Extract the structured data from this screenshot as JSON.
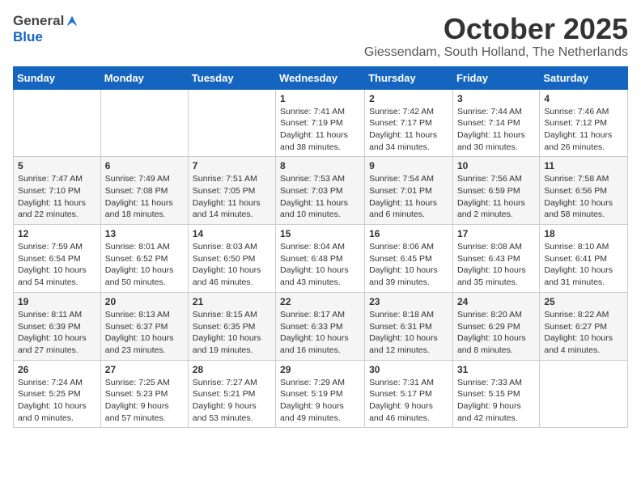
{
  "header": {
    "logo_general": "General",
    "logo_blue": "Blue",
    "month_title": "October 2025",
    "location": "Giessendam, South Holland, The Netherlands"
  },
  "calendar": {
    "days_of_week": [
      "Sunday",
      "Monday",
      "Tuesday",
      "Wednesday",
      "Thursday",
      "Friday",
      "Saturday"
    ],
    "weeks": [
      [
        {
          "day": "",
          "info": ""
        },
        {
          "day": "",
          "info": ""
        },
        {
          "day": "",
          "info": ""
        },
        {
          "day": "1",
          "info": "Sunrise: 7:41 AM\nSunset: 7:19 PM\nDaylight: 11 hours\nand 38 minutes."
        },
        {
          "day": "2",
          "info": "Sunrise: 7:42 AM\nSunset: 7:17 PM\nDaylight: 11 hours\nand 34 minutes."
        },
        {
          "day": "3",
          "info": "Sunrise: 7:44 AM\nSunset: 7:14 PM\nDaylight: 11 hours\nand 30 minutes."
        },
        {
          "day": "4",
          "info": "Sunrise: 7:46 AM\nSunset: 7:12 PM\nDaylight: 11 hours\nand 26 minutes."
        }
      ],
      [
        {
          "day": "5",
          "info": "Sunrise: 7:47 AM\nSunset: 7:10 PM\nDaylight: 11 hours\nand 22 minutes."
        },
        {
          "day": "6",
          "info": "Sunrise: 7:49 AM\nSunset: 7:08 PM\nDaylight: 11 hours\nand 18 minutes."
        },
        {
          "day": "7",
          "info": "Sunrise: 7:51 AM\nSunset: 7:05 PM\nDaylight: 11 hours\nand 14 minutes."
        },
        {
          "day": "8",
          "info": "Sunrise: 7:53 AM\nSunset: 7:03 PM\nDaylight: 11 hours\nand 10 minutes."
        },
        {
          "day": "9",
          "info": "Sunrise: 7:54 AM\nSunset: 7:01 PM\nDaylight: 11 hours\nand 6 minutes."
        },
        {
          "day": "10",
          "info": "Sunrise: 7:56 AM\nSunset: 6:59 PM\nDaylight: 11 hours\nand 2 minutes."
        },
        {
          "day": "11",
          "info": "Sunrise: 7:58 AM\nSunset: 6:56 PM\nDaylight: 10 hours\nand 58 minutes."
        }
      ],
      [
        {
          "day": "12",
          "info": "Sunrise: 7:59 AM\nSunset: 6:54 PM\nDaylight: 10 hours\nand 54 minutes."
        },
        {
          "day": "13",
          "info": "Sunrise: 8:01 AM\nSunset: 6:52 PM\nDaylight: 10 hours\nand 50 minutes."
        },
        {
          "day": "14",
          "info": "Sunrise: 8:03 AM\nSunset: 6:50 PM\nDaylight: 10 hours\nand 46 minutes."
        },
        {
          "day": "15",
          "info": "Sunrise: 8:04 AM\nSunset: 6:48 PM\nDaylight: 10 hours\nand 43 minutes."
        },
        {
          "day": "16",
          "info": "Sunrise: 8:06 AM\nSunset: 6:45 PM\nDaylight: 10 hours\nand 39 minutes."
        },
        {
          "day": "17",
          "info": "Sunrise: 8:08 AM\nSunset: 6:43 PM\nDaylight: 10 hours\nand 35 minutes."
        },
        {
          "day": "18",
          "info": "Sunrise: 8:10 AM\nSunset: 6:41 PM\nDaylight: 10 hours\nand 31 minutes."
        }
      ],
      [
        {
          "day": "19",
          "info": "Sunrise: 8:11 AM\nSunset: 6:39 PM\nDaylight: 10 hours\nand 27 minutes."
        },
        {
          "day": "20",
          "info": "Sunrise: 8:13 AM\nSunset: 6:37 PM\nDaylight: 10 hours\nand 23 minutes."
        },
        {
          "day": "21",
          "info": "Sunrise: 8:15 AM\nSunset: 6:35 PM\nDaylight: 10 hours\nand 19 minutes."
        },
        {
          "day": "22",
          "info": "Sunrise: 8:17 AM\nSunset: 6:33 PM\nDaylight: 10 hours\nand 16 minutes."
        },
        {
          "day": "23",
          "info": "Sunrise: 8:18 AM\nSunset: 6:31 PM\nDaylight: 10 hours\nand 12 minutes."
        },
        {
          "day": "24",
          "info": "Sunrise: 8:20 AM\nSunset: 6:29 PM\nDaylight: 10 hours\nand 8 minutes."
        },
        {
          "day": "25",
          "info": "Sunrise: 8:22 AM\nSunset: 6:27 PM\nDaylight: 10 hours\nand 4 minutes."
        }
      ],
      [
        {
          "day": "26",
          "info": "Sunrise: 7:24 AM\nSunset: 5:25 PM\nDaylight: 10 hours\nand 0 minutes."
        },
        {
          "day": "27",
          "info": "Sunrise: 7:25 AM\nSunset: 5:23 PM\nDaylight: 9 hours\nand 57 minutes."
        },
        {
          "day": "28",
          "info": "Sunrise: 7:27 AM\nSunset: 5:21 PM\nDaylight: 9 hours\nand 53 minutes."
        },
        {
          "day": "29",
          "info": "Sunrise: 7:29 AM\nSunset: 5:19 PM\nDaylight: 9 hours\nand 49 minutes."
        },
        {
          "day": "30",
          "info": "Sunrise: 7:31 AM\nSunset: 5:17 PM\nDaylight: 9 hours\nand 46 minutes."
        },
        {
          "day": "31",
          "info": "Sunrise: 7:33 AM\nSunset: 5:15 PM\nDaylight: 9 hours\nand 42 minutes."
        },
        {
          "day": "",
          "info": ""
        }
      ]
    ]
  }
}
